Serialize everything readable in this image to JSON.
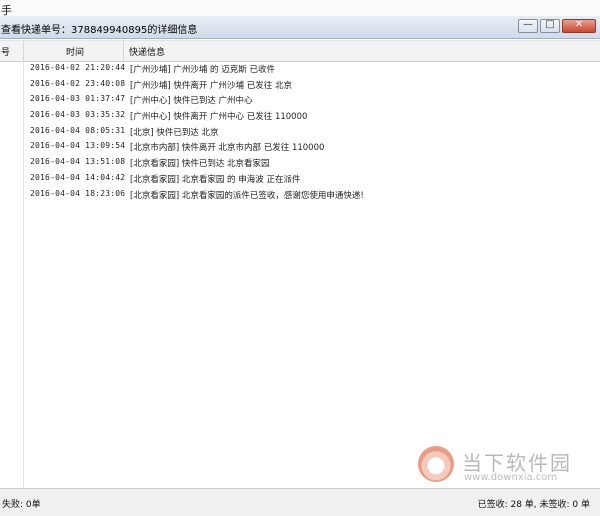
{
  "app": {
    "strip_text": "手"
  },
  "dialog": {
    "title": "查看快递单号：378849940895的详细信息",
    "buttons": {
      "minimize": "—",
      "maximize": "□",
      "close": "✕"
    }
  },
  "table": {
    "headers": {
      "index": "号",
      "time": "时间",
      "info": "快递信息"
    },
    "rows": [
      {
        "time": "2016-04-02 21:20:44",
        "info": "[广州沙埔] 广州沙埔 的 迈克斯 已收件"
      },
      {
        "time": "2016-04-02 23:40:08",
        "info": "[广州沙埔] 快件离开 广州沙埔 已发往 北京"
      },
      {
        "time": "2016-04-03 01:37:47",
        "info": "[广州中心] 快件已到达 广州中心"
      },
      {
        "time": "2016-04-03 03:35:32",
        "info": "[广州中心] 快件离开 广州中心 已发往 110000"
      },
      {
        "time": "2016-04-04 08:05:31",
        "info": "[北京] 快件已到达 北京"
      },
      {
        "time": "2016-04-04 13:09:54",
        "info": "[北京市内部] 快件离开 北京市内部 已发往 110000"
      },
      {
        "time": "2016-04-04 13:51:08",
        "info": "[北京看家园] 快件已到达 北京看家园"
      },
      {
        "time": "2016-04-04 14:04:42",
        "info": "[北京看家园] 北京看家园 的 申海波 正在派件"
      },
      {
        "time": "2016-04-04 18:23:06",
        "info": "[北京看家园] 北京看家园的派件已签收，感谢您使用申通快递!"
      }
    ]
  },
  "watermark": {
    "title": "当下软件园",
    "url": "www.downxia.com"
  },
  "status": {
    "left": "失败: 0单",
    "right": "已签收:   28 单, 未签收:   0 单"
  }
}
